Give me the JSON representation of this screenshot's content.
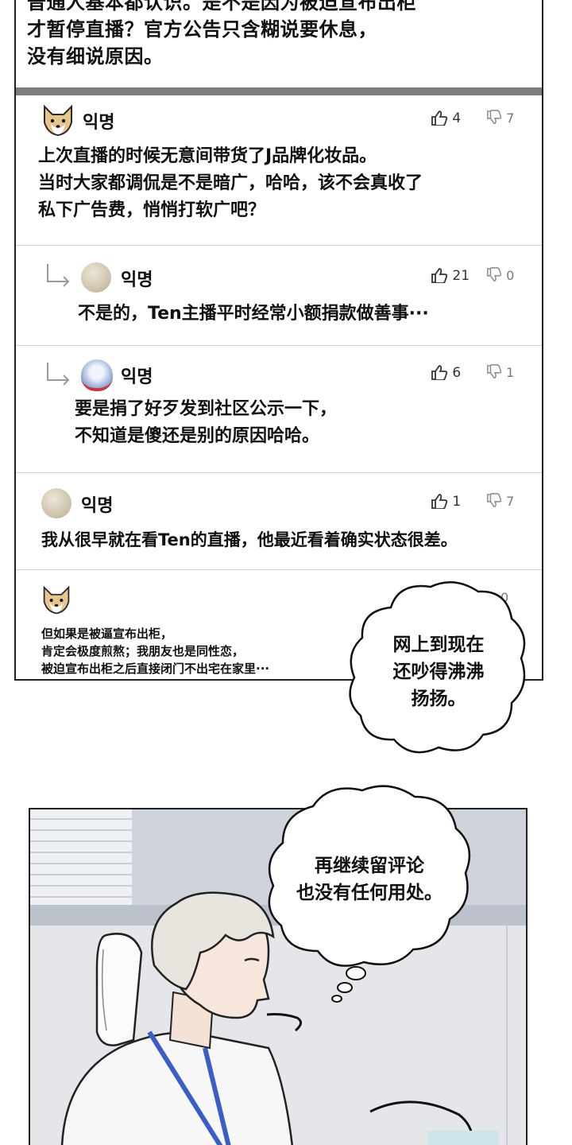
{
  "post": {
    "lines": [
      "普通人基本都认识。是不是因为被迫宣布出柜",
      "才暂停直播？官方公告只含糊说要休息，",
      "没有细说原因。"
    ]
  },
  "comments": [
    {
      "avatar": "shiba-dog-icon",
      "author": "익명",
      "likes": "4",
      "dislikes": "7",
      "lines": [
        "上次直播的时候无意间带货了J品牌化妆品。",
        "当时大家都调侃是不是暗广，哈哈，该不会真收了",
        "私下广告费，悄悄打软广吧？"
      ]
    },
    {
      "avatar": "beige-circle-avatar",
      "author": "익명",
      "likes": "21",
      "dislikes": "0",
      "lines": [
        "不是的，Ten主播平时经常小额捐款做善事···"
      ]
    },
    {
      "avatar": "bear-avatar",
      "author": "익명",
      "likes": "6",
      "dislikes": "1",
      "lines": [
        "要是捐了好歹发到社区公示一下，",
        "不知道是傻还是别的原因哈哈。"
      ]
    },
    {
      "avatar": "beige-circle-avatar",
      "author": "익명",
      "likes": "1",
      "dislikes": "7",
      "lines": [
        "我从很早就在看Ten的直播，他最近看着确实状态很差。"
      ]
    },
    {
      "avatar": "shiba-dog-icon",
      "author": "",
      "likes": "",
      "dislikes": "0",
      "lines": [
        "但如果是被逼宣布出柜，",
        "肯定会极度煎熬；我朋友也是同性恋，",
        "被迫宣布出柜之后直接闭门不出宅在家里···"
      ]
    }
  ],
  "bubbles": {
    "bubble1": [
      "网上到现在",
      "还吵得沸沸",
      "扬扬。"
    ],
    "bubble2": [
      "再继续留评论",
      "也没有任何用处。"
    ]
  },
  "colors": {
    "separator": "#7d7d7d",
    "line": "#cfcfcf",
    "tie": "#3a5ec4"
  }
}
